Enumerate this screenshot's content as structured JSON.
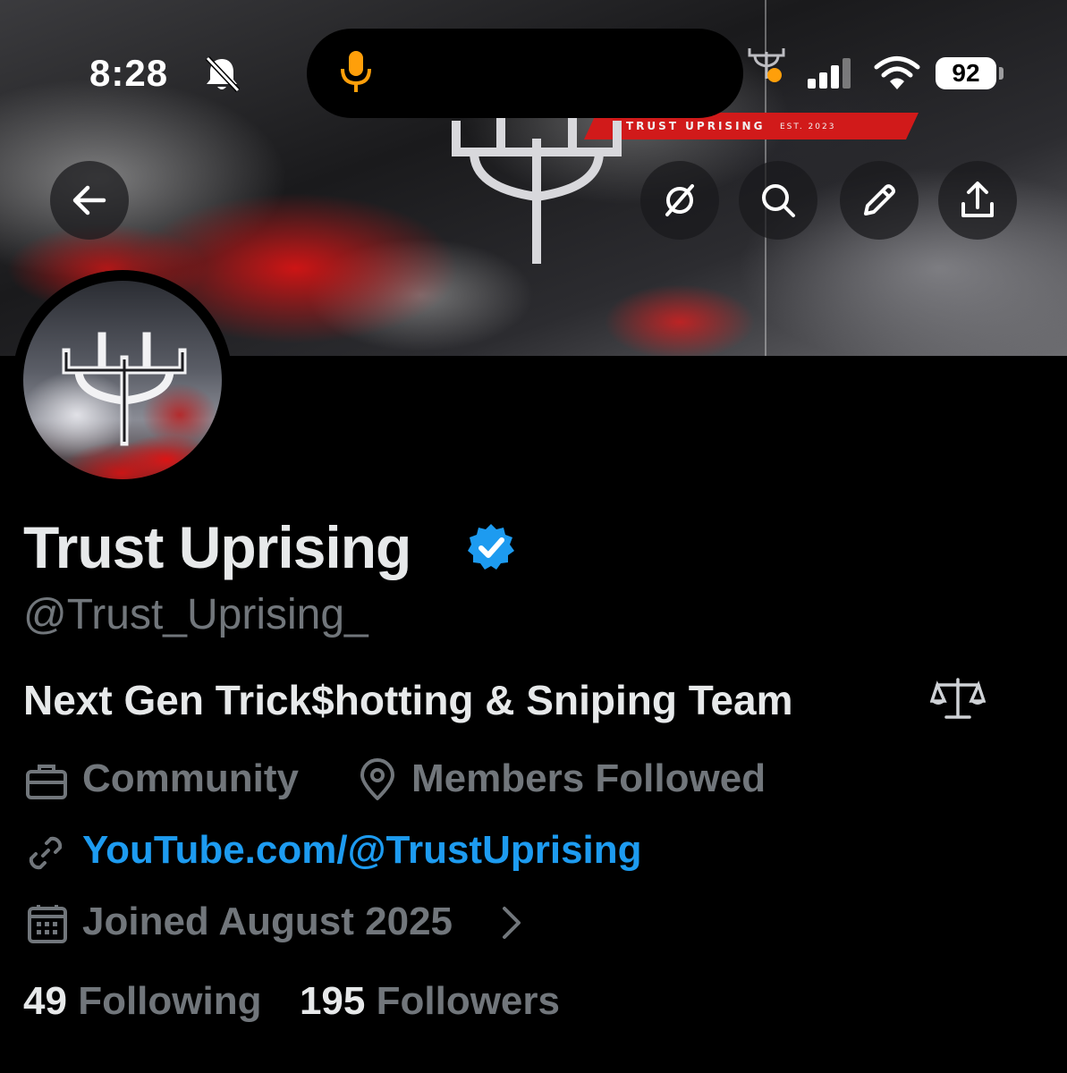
{
  "status_bar": {
    "time": "8:28",
    "battery": "92",
    "icons": [
      "bell-slash-icon",
      "microphone-icon",
      "signal-icon",
      "wifi-icon",
      "battery-icon"
    ]
  },
  "banner": {
    "strip_text": "TRUST UPRISING",
    "strip_est": "EST. 2023"
  },
  "header_buttons": {
    "back": "arrow-left-icon",
    "grok": "grok-icon",
    "search": "search-icon",
    "edit": "pencil-icon",
    "share": "share-icon"
  },
  "profile": {
    "name": "Trust Uprising",
    "handle": "@Trust_Uprising_",
    "bio": "Next Gen Trick$hotting & Sniping Team",
    "bio_emoji": "⚖️",
    "category": "Community",
    "location": "Members Followed",
    "link": "YouTube.com/@TrustUprising",
    "joined": "Joined August 2025",
    "following_count": "49",
    "following_label": "Following",
    "followers_count": "195",
    "followers_label": "Followers"
  },
  "colors": {
    "background": "#000000",
    "text_primary": "#e7e9ea",
    "text_secondary": "#71767b",
    "link": "#1d9bf0",
    "verified": "#1d9bf0",
    "brand_red": "#d11a1a",
    "status_orange": "#ff9f0a"
  }
}
